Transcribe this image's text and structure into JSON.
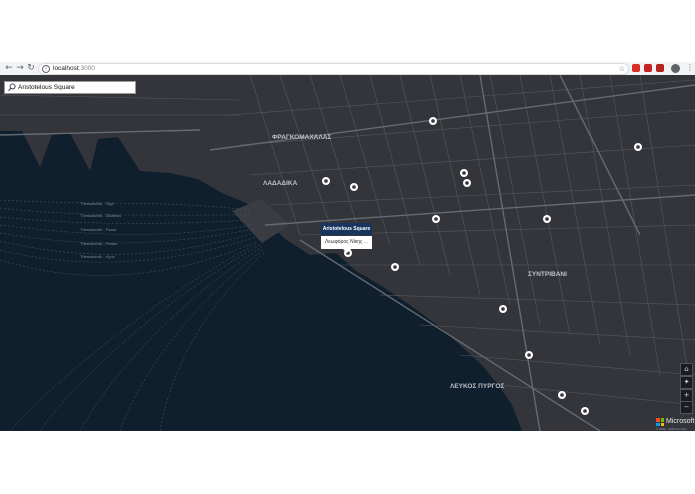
{
  "browser": {
    "url_host": "localhost",
    "url_port": ":3000",
    "back_icon": "arrow-left-icon",
    "forward_icon": "arrow-right-icon",
    "reload_icon": "reload-icon",
    "star_icon": "star-icon",
    "menu_icon": "more-vertical-icon"
  },
  "search": {
    "value": "Aristotelous Square",
    "icon": "search-icon"
  },
  "map": {
    "district_labels": [
      "ΦΡΑΓΚΟΜΑΧΑΛΑΣ",
      "ΛΑΔΑΔΙΚΑ",
      "ΣΥΝΤΡΙΒΑΝΙ",
      "ΛΕΥΚΟΣ ΠΥΡΓΟΣ"
    ],
    "ferry_route_labels": [
      "Thessaloniki - Sigri",
      "Thessaloniki - Skiathos",
      "Thessaloniki - Psara",
      "Thessaloniki - Parian",
      "Thessaloniki - Kymi"
    ],
    "colors": {
      "land": "#33353b",
      "water": "#0f1f2e",
      "road": "#55585f",
      "road_major": "#676a72",
      "pin": "#ffffff",
      "popup_header": "#17355f"
    }
  },
  "popup": {
    "title": "Aristotelous Square",
    "street": "Λεωφόρος Νίκης",
    "ellipsis": "..."
  },
  "controls": {
    "home_icon": "home-icon",
    "compass_icon": "compass-icon",
    "zoom_in": "+",
    "zoom_out": "−"
  },
  "branding": {
    "logo_text": "Microsoft",
    "copyright": "© 2020 · 2019 TomTom"
  }
}
